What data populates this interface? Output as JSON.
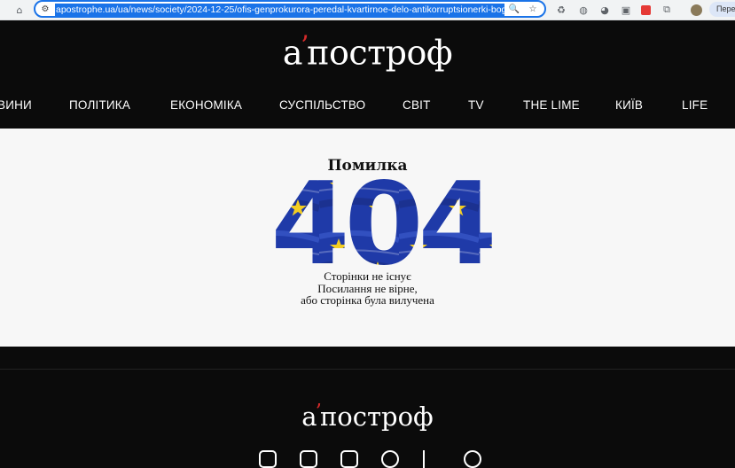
{
  "browser": {
    "url": "apostrophe.ua/ua/news/society/2024-12-25/ofis-genprokurora-peredal-kvartirnoe-delo-antikorruptsionerki-boguslavets-v-nabu",
    "profile_label": "Перез"
  },
  "header": {
    "logo_text": "апостроф",
    "nav": [
      "ВИНИ",
      "ПОЛІТИКА",
      "ЕКОНОМІКА",
      "СУСПІЛЬСТВО",
      "СВІТ",
      "TV",
      "THE LIME",
      "КИЇВ",
      "LIFE"
    ]
  },
  "error": {
    "title": "Помилка",
    "code": "404",
    "line1": "Сторінки не існує",
    "line2": "Посилання не вірне,",
    "line3": "або сторінка була вилучена"
  },
  "footer": {
    "logo_text": "апостроф",
    "social_icons": [
      "instagram-icon",
      "facebook-icon",
      "x-icon",
      "telegram-icon",
      "tiktok-icon",
      "threads-icon"
    ]
  },
  "colors": {
    "background": "#0b0b0b",
    "accent": "#d42a2a",
    "eu_blue": "#1f3aa8",
    "eu_star": "#f3cd22"
  }
}
